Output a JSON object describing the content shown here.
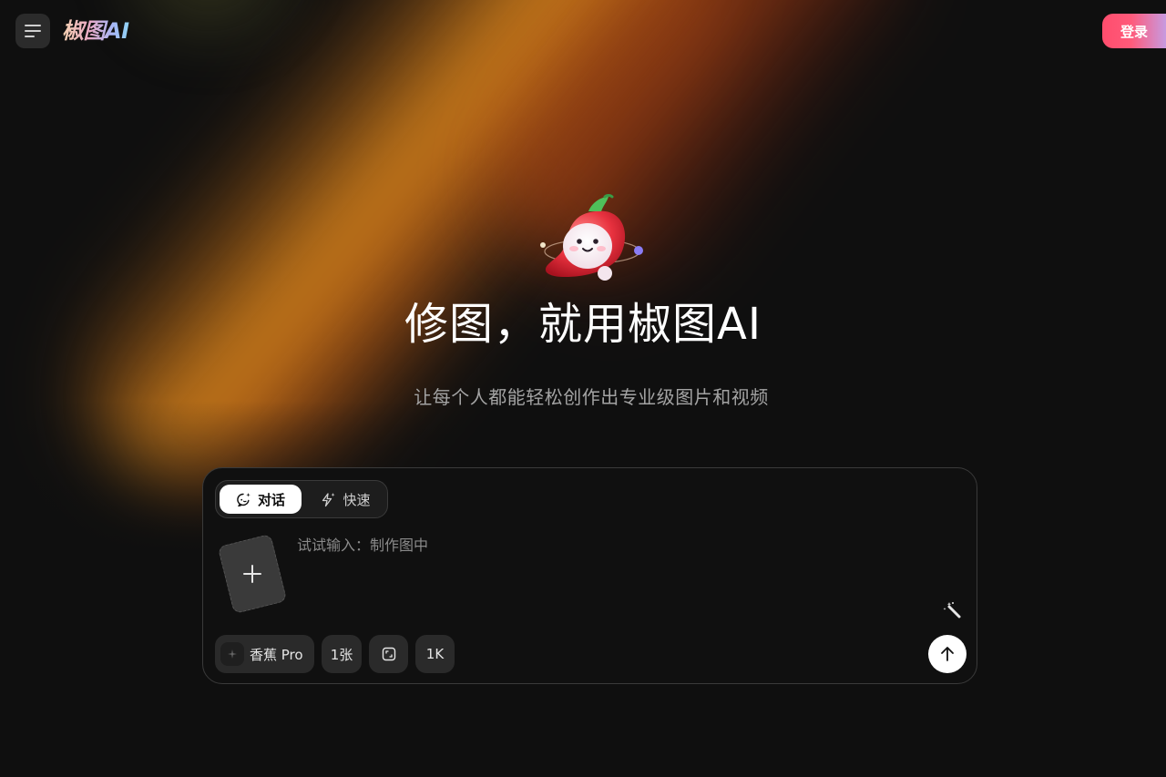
{
  "header": {
    "logo_text": "椒图AI",
    "login_label": "登录",
    "menu_icon": "hamburger-menu-icon"
  },
  "hero": {
    "title": "修图，就用椒图AI",
    "subtitle": "让每个人都能轻松创作出专业级图片和视频",
    "mascot_icon": "chili-pepper-mascot-icon"
  },
  "composer": {
    "tabs": [
      {
        "label": "对话",
        "icon": "chat-sparkle-icon",
        "active": true
      },
      {
        "label": "快速",
        "icon": "lightning-sparkle-icon",
        "active": false
      }
    ],
    "upload_icon": "plus-icon",
    "input_placeholder": "试试输入：制作图中",
    "magic_icon": "magic-wand-icon",
    "model_label": "香蕉 Pro",
    "count_label": "1张",
    "ratio_icon": "aspect-ratio-icon",
    "resolution_label": "1K",
    "send_icon": "arrow-up-icon"
  },
  "colors": {
    "background": "#0f0f0f",
    "login_gradient_start": "#ff4d6d",
    "login_gradient_end": "#c79ae0",
    "panel_border": "#3a3a3a",
    "chip_bg": "#2a2a2a"
  }
}
